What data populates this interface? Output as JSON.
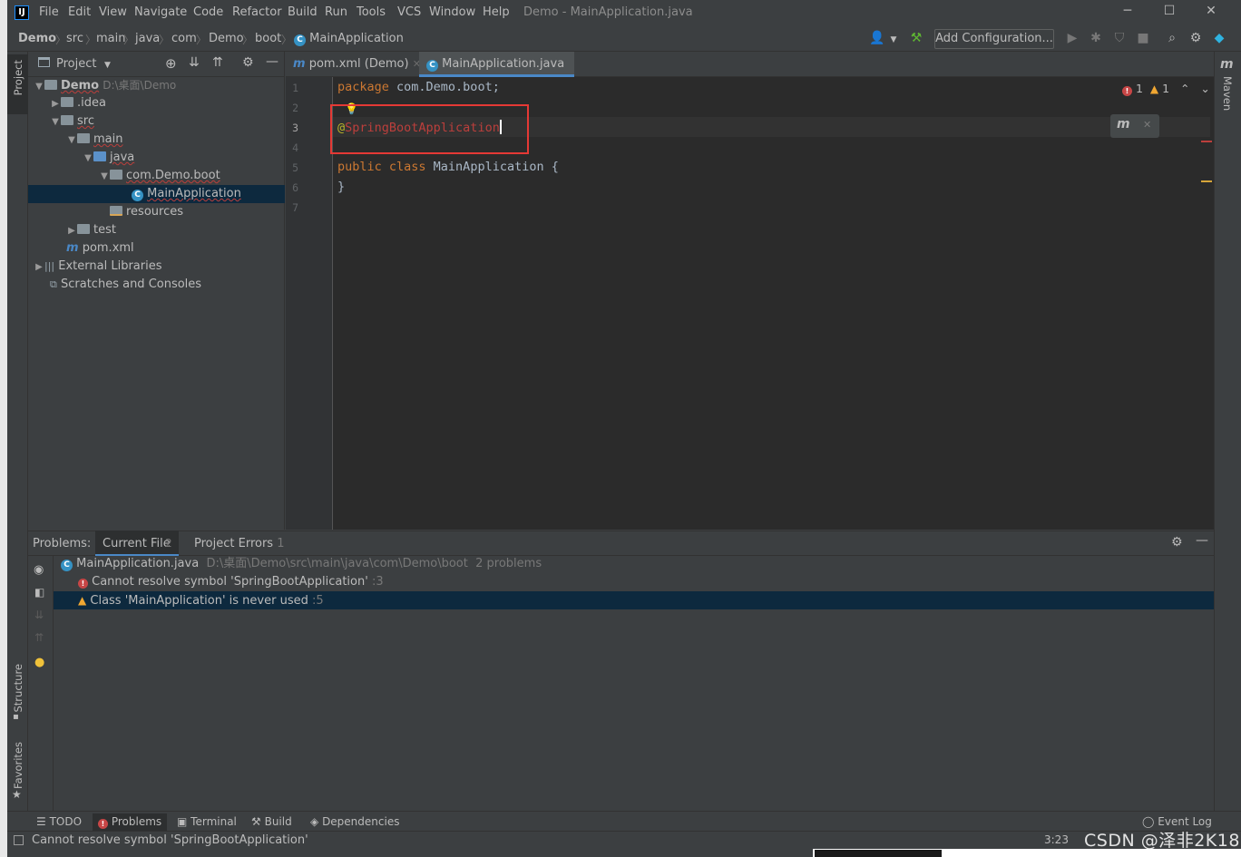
{
  "window": {
    "title": "Demo - MainApplication.java",
    "app_icon": "IJ",
    "menu": [
      "File",
      "Edit",
      "View",
      "Navigate",
      "Code",
      "Refactor",
      "Build",
      "Run",
      "Tools",
      "VCS",
      "Window",
      "Help"
    ],
    "controls": {
      "minimize": "─",
      "maximize": "☐",
      "close": "✕"
    }
  },
  "breadcrumbs": [
    "Demo",
    "src",
    "main",
    "java",
    "com",
    "Demo",
    "boot",
    "MainApplication"
  ],
  "toolbar": {
    "add_configuration": "Add Configuration..."
  },
  "left_strip": {
    "project": "Project",
    "structure": "Structure",
    "favorites": "Favorites"
  },
  "right_strip": {
    "maven": "Maven",
    "maven_icon": "m"
  },
  "project_panel": {
    "title": "Project",
    "tree": [
      {
        "label": "Demo",
        "path": "D:\\桌面\\Demo"
      },
      {
        "label": ".idea"
      },
      {
        "label": "src"
      },
      {
        "label": "main"
      },
      {
        "label": "java"
      },
      {
        "label": "com.Demo.boot"
      },
      {
        "label": "MainApplication"
      },
      {
        "label": "resources"
      },
      {
        "label": "test"
      },
      {
        "label": "pom.xml"
      },
      {
        "label": "External Libraries"
      },
      {
        "label": "Scratches and Consoles"
      }
    ]
  },
  "editor": {
    "tabs": [
      {
        "label": "pom.xml (Demo)"
      },
      {
        "label": "MainApplication.java"
      }
    ],
    "line_numbers": [
      "1",
      "2",
      "3",
      "4",
      "5",
      "6",
      "7"
    ],
    "code": {
      "l1_kw": "package",
      "l1_rest": " com.Demo.boot;",
      "l3_at": "@",
      "l3_ann": "SpringBootApplication",
      "l5_kw": "public class",
      "l5_rest": " MainApplication {",
      "l6": "}"
    },
    "inspection": {
      "errors": "1",
      "warnings": "1"
    }
  },
  "problems": {
    "label": "Problems:",
    "tabs": [
      {
        "label": "Current File",
        "count": "2"
      },
      {
        "label": "Project Errors",
        "count": "1"
      }
    ],
    "file": {
      "name": "MainApplication.java",
      "path": "D:\\桌面\\Demo\\src\\main\\java\\com\\Demo\\boot",
      "summary": "2 problems"
    },
    "items": [
      {
        "severity": "error",
        "text": "Cannot resolve symbol 'SpringBootApplication'",
        "line": ":3"
      },
      {
        "severity": "warning",
        "text": "Class 'MainApplication' is never used",
        "line": ":5"
      }
    ]
  },
  "bottom_tabs": [
    "TODO",
    "Problems",
    "Terminal",
    "Build",
    "Dependencies"
  ],
  "event_log": "Event Log",
  "status": {
    "message": "Cannot resolve symbol 'SpringBootApplication'",
    "position": "3:23",
    "watermark": "CSDN @泽非2K18"
  },
  "colors": {
    "accent": "#4a88c7",
    "error": "#bc3f3c",
    "warning": "#f0a732",
    "highlight_box": "#e53935"
  }
}
